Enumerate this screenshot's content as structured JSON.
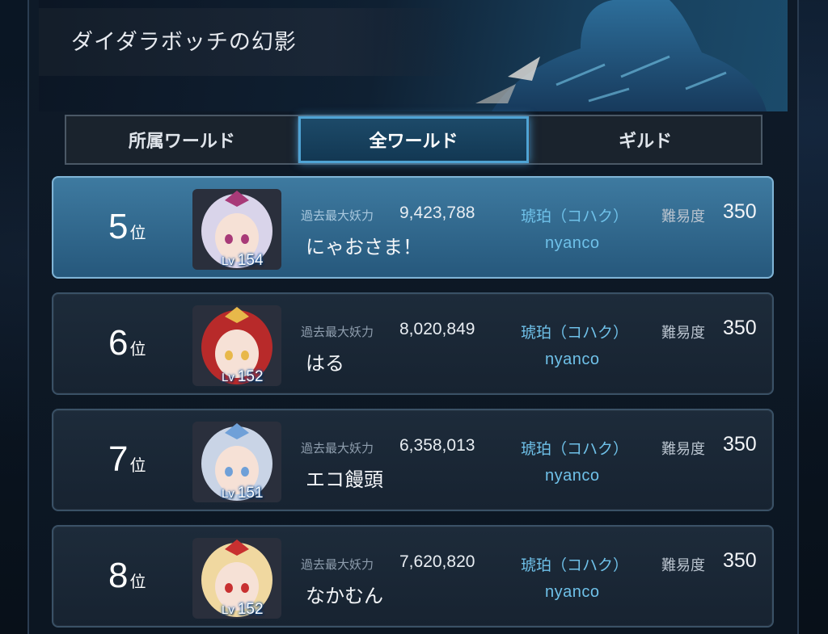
{
  "header": {
    "title": "ダイダラボッチの幻影"
  },
  "tabs": [
    {
      "label": "所属ワールド",
      "active": false
    },
    {
      "label": "全ワールド",
      "active": true
    },
    {
      "label": "ギルド",
      "active": false
    }
  ],
  "labels": {
    "power_label": "過去最大妖力",
    "difficulty_label": "難易度",
    "rank_suffix": "位",
    "level_prefix": "Lv"
  },
  "rankings": [
    {
      "rank": "5",
      "level": "154",
      "power": "9,423,788",
      "name": "にゃおさま！",
      "world": "琥珀（コハク）",
      "guild": "nyanco",
      "difficulty": "350",
      "highlighted": true,
      "avatar_hair": "#d9d4ea",
      "avatar_accent": "#a83a78"
    },
    {
      "rank": "6",
      "level": "152",
      "power": "8,020,849",
      "name": "はる",
      "world": "琥珀（コハク）",
      "guild": "nyanco",
      "difficulty": "350",
      "highlighted": false,
      "avatar_hair": "#b82a2a",
      "avatar_accent": "#e8b84a"
    },
    {
      "rank": "7",
      "level": "151",
      "power": "6,358,013",
      "name": "エコ饅頭",
      "world": "琥珀（コハク）",
      "guild": "nyanco",
      "difficulty": "350",
      "highlighted": false,
      "avatar_hair": "#c9d4e6",
      "avatar_accent": "#6fa0d8"
    },
    {
      "rank": "8",
      "level": "152",
      "power": "7,620,820",
      "name": "なかむん",
      "world": "琥珀（コハク）",
      "guild": "nyanco",
      "difficulty": "350",
      "highlighted": false,
      "avatar_hair": "#f0d8a0",
      "avatar_accent": "#c83030"
    }
  ],
  "colors": {
    "accent_blue": "#4fa3d4",
    "world_text": "#6fc1e9",
    "highlight_row": "#3e7aa0"
  }
}
